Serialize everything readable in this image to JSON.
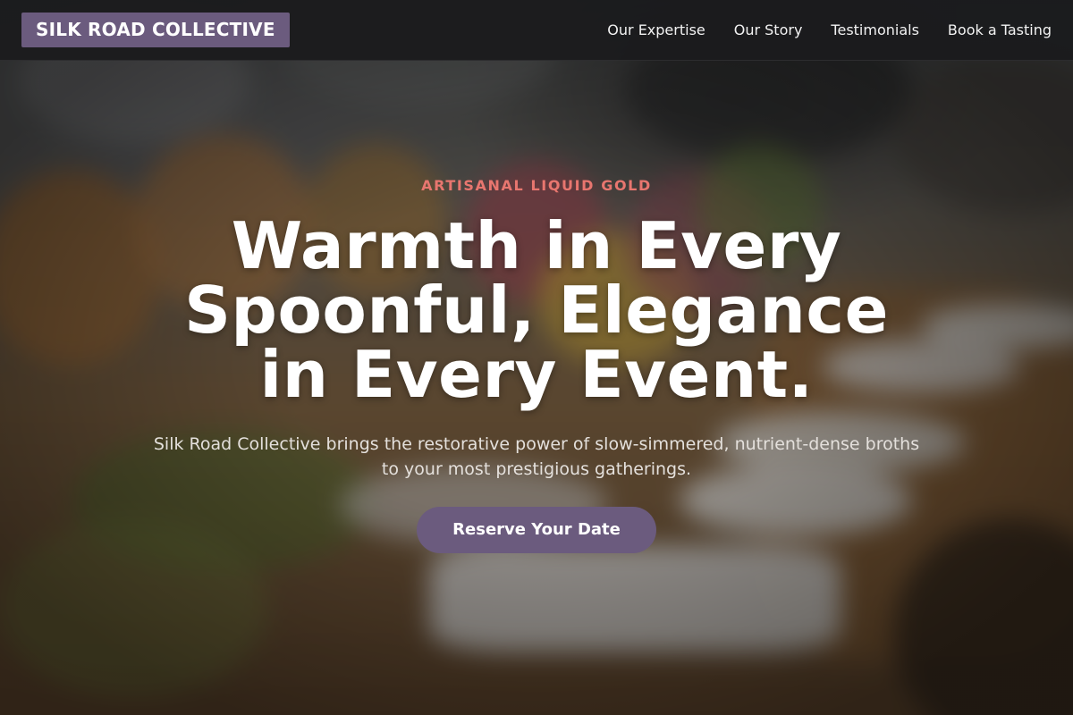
{
  "nav": {
    "logo": "SILK ROAD COLLECTIVE",
    "links": [
      "Our Expertise",
      "Our Story",
      "Testimonials",
      "Book a Tasting"
    ]
  },
  "hero": {
    "eyebrow": "ARTISANAL LIQUID GOLD",
    "headline": "Warmth in Every Spoonful, Elegance in Every Event.",
    "subtitle": "Silk Road Collective brings the restorative power of slow-simmered, nutrient-dense broths to your most prestigious gatherings.",
    "cta_label": "Reserve Your Date",
    "background_image": "blurred-banquet-table-photo"
  },
  "colors": {
    "brand_purple": "#6b5b7e",
    "eyebrow_coral": "#e8766f",
    "navbar_bg": "#1c1c1e"
  }
}
